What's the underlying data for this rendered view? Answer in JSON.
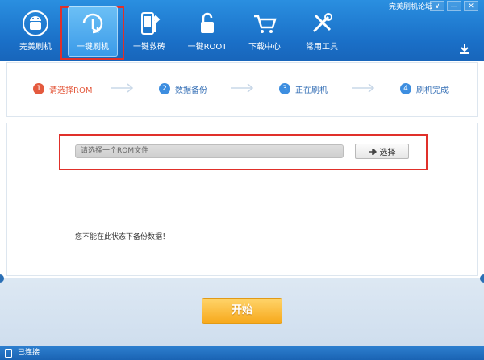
{
  "window": {
    "title": "完美刷机论坛",
    "min_label": "—",
    "close_label": "✕",
    "menu_label": "∨"
  },
  "nav": {
    "items": [
      {
        "label": "完美刷机",
        "icon": "android-icon"
      },
      {
        "label": "一键刷机",
        "icon": "touch-refresh-icon"
      },
      {
        "label": "一键救砖",
        "icon": "phone-repair-icon"
      },
      {
        "label": "一键ROOT",
        "icon": "unlock-icon"
      },
      {
        "label": "下载中心",
        "icon": "cart-icon"
      },
      {
        "label": "常用工具",
        "icon": "tools-icon"
      }
    ],
    "active_index": 1
  },
  "steps": [
    {
      "num": "1",
      "label": "请选择ROM",
      "state": "current"
    },
    {
      "num": "2",
      "label": "数据备份",
      "state": "pending"
    },
    {
      "num": "3",
      "label": "正在刷机",
      "state": "pending"
    },
    {
      "num": "4",
      "label": "刷机完成",
      "state": "pending"
    }
  ],
  "rom": {
    "placeholder": "请选择一个ROM文件",
    "select_label": "选择"
  },
  "notice": "您不能在此状态下备份数据！",
  "start_label": "开始",
  "status": "已连接",
  "colors": {
    "header": "#1a6fc7",
    "accent_red": "#e45a3e",
    "step_blue": "#3d8ee0",
    "start_orange": "#f7a91c"
  }
}
